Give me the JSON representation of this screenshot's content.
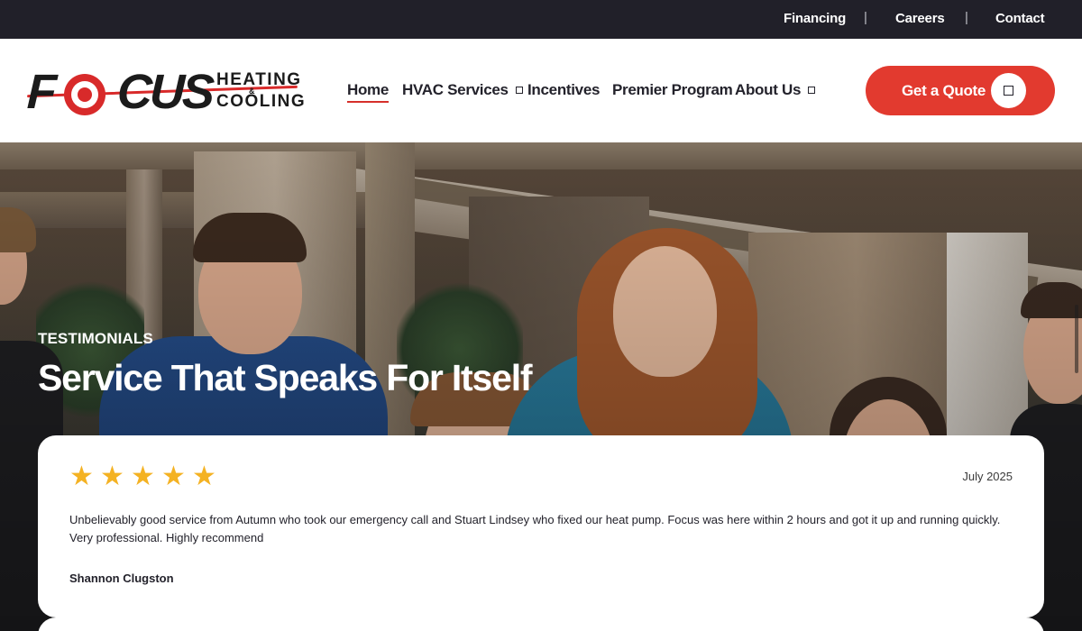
{
  "topbar": {
    "links": [
      {
        "label": "Financing"
      },
      {
        "label": "Careers"
      },
      {
        "label": "Contact"
      }
    ],
    "separator": "|"
  },
  "header": {
    "logo": {
      "wordmark_first": "F",
      "wordmark_rest": "CUS",
      "line1": "HEATING",
      "ampersand": "&",
      "line2": "COOLING"
    },
    "nav": [
      {
        "label": "Home",
        "active": true,
        "dropdown": false
      },
      {
        "label": "HVAC Services",
        "active": false,
        "dropdown": true
      },
      {
        "label": "Incentives",
        "active": false,
        "dropdown": false
      },
      {
        "label": "Premier Program",
        "active": false,
        "dropdown": false
      },
      {
        "label": "About Us",
        "active": false,
        "dropdown": true
      }
    ],
    "cta": {
      "label": "Get a Quote",
      "icon": "square-icon"
    }
  },
  "hero": {
    "eyebrow": "TESTIMONIALS",
    "title": "Service That Speaks For Itself"
  },
  "testimonial": {
    "rating": 5,
    "rating_max": 5,
    "star_glyph": "★",
    "date": "July 2025",
    "text": "Unbelievably good service from Autumn who took our emergency call and Stuart Lindsey who fixed our heat pump. Focus was here within 2 hours and got it up and running quickly. Very professional. Highly recommend",
    "author": "Shannon Clugston"
  },
  "colors": {
    "brand_red": "#e23a2f",
    "topbar_bg": "#212029",
    "star": "#f4b223",
    "text_dark": "#23222b"
  }
}
